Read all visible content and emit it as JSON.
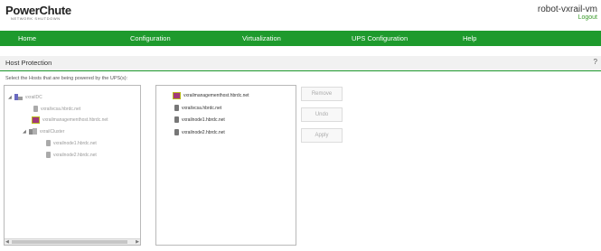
{
  "app": {
    "logo_main": "PowerChute",
    "logo_sub": "NETWORK SHUTDOWN"
  },
  "header": {
    "host": "robot-vxrail-vm",
    "logout": "Logout"
  },
  "nav": [
    "Home",
    "Configuration",
    "Virtualization",
    "UPS Configuration",
    "Help"
  ],
  "section": {
    "title": "Host Protection",
    "help": "?"
  },
  "instruction": "Select the Hosts that are being powered by the UPS(s):",
  "left_tree": {
    "datacenter": "vxrailDC",
    "items": [
      "vxrailvcsa.hbrdc.net",
      "vxrailmanagementhost.hbrdc.net"
    ],
    "cluster": "vxrailCluster",
    "cluster_items": [
      "vxrailnode1.hbrdc.net",
      "vxrailnode2.hbrdc.net"
    ],
    "scroll_left": "◀",
    "scroll_right": "▶"
  },
  "right_list": [
    "vxrailmanagementhost.hbrdc.net",
    "vxrailvcsa.hbrdc.net",
    "vxrailnode1.hbrdc.net",
    "vxrailnode2.hbrdc.net"
  ],
  "buttons": {
    "remove": "Remove",
    "undo": "Undo",
    "apply": "Apply"
  },
  "icons": {
    "expand": "triangle-down-icon",
    "datacenter": "datacenter-icon",
    "cluster": "cluster-icon",
    "host": "server-icon",
    "vm": "vm-icon"
  },
  "colors": {
    "nav_bg": "#1e9a2d",
    "logout": "#3a9a2a",
    "section_border": "#1e9a2d"
  }
}
